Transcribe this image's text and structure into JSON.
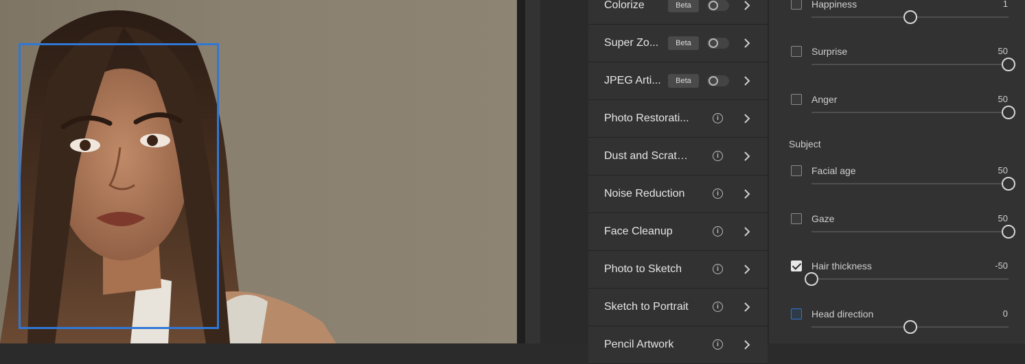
{
  "canvas": {
    "face_box_color": "#2f78d8"
  },
  "filters": [
    {
      "label": "Colorize",
      "badge": "Beta",
      "control": "toggle"
    },
    {
      "label": "Super Zo...",
      "badge": "Beta",
      "control": "toggle"
    },
    {
      "label": "JPEG Arti...",
      "badge": "Beta",
      "control": "toggle"
    },
    {
      "label": "Photo Restorati...",
      "badge": "",
      "control": "info"
    },
    {
      "label": "Dust and Scratc...",
      "badge": "",
      "control": "info"
    },
    {
      "label": "Noise Reduction",
      "badge": "",
      "control": "info"
    },
    {
      "label": "Face Cleanup",
      "badge": "",
      "control": "info"
    },
    {
      "label": "Photo to Sketch",
      "badge": "",
      "control": "info"
    },
    {
      "label": "Sketch to Portrait",
      "badge": "",
      "control": "info"
    },
    {
      "label": "Pencil Artwork",
      "badge": "",
      "control": "info"
    }
  ],
  "expression": {
    "sliders": [
      {
        "label": "Happiness",
        "value": "1",
        "level": 0.5,
        "checked": false
      },
      {
        "label": "Surprise",
        "value": "50",
        "level": 1.0,
        "checked": false
      },
      {
        "label": "Anger",
        "value": "50",
        "level": 1.0,
        "checked": false
      }
    ]
  },
  "subject": {
    "heading": "Subject",
    "sliders": [
      {
        "label": "Facial age",
        "value": "50",
        "level": 1.0,
        "checked": false
      },
      {
        "label": "Gaze",
        "value": "50",
        "level": 1.0,
        "checked": false
      },
      {
        "label": "Hair thickness",
        "value": "-50",
        "level": 0.0,
        "checked": true
      },
      {
        "label": "Head direction",
        "value": "0",
        "level": 0.5,
        "checked": false,
        "focused": true
      }
    ]
  },
  "colors": {
    "accent": "#2f78d8",
    "panel": "#323232",
    "text": "#e6e6e6"
  }
}
